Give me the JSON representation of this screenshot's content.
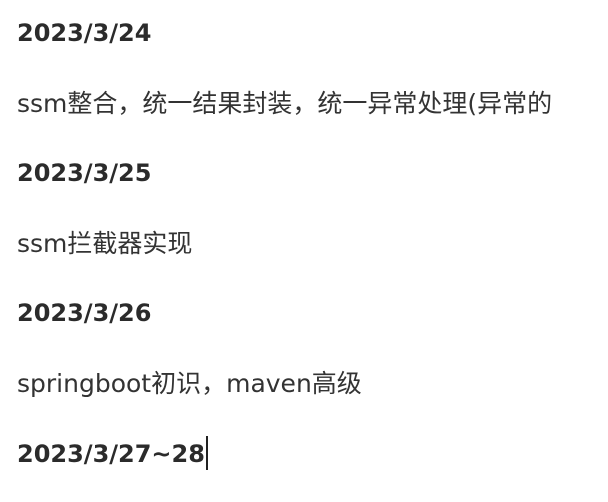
{
  "document": {
    "entries": [
      {
        "date": "2023/3/24",
        "text": "ssm整合，统一结果封装，统一异常处理(异常的"
      },
      {
        "date": "2023/3/25",
        "text": "ssm拦截器实现"
      },
      {
        "date": "2023/3/26",
        "text": "springboot初识，maven高级"
      },
      {
        "date": "2023/3/27~28",
        "text": ""
      }
    ]
  }
}
